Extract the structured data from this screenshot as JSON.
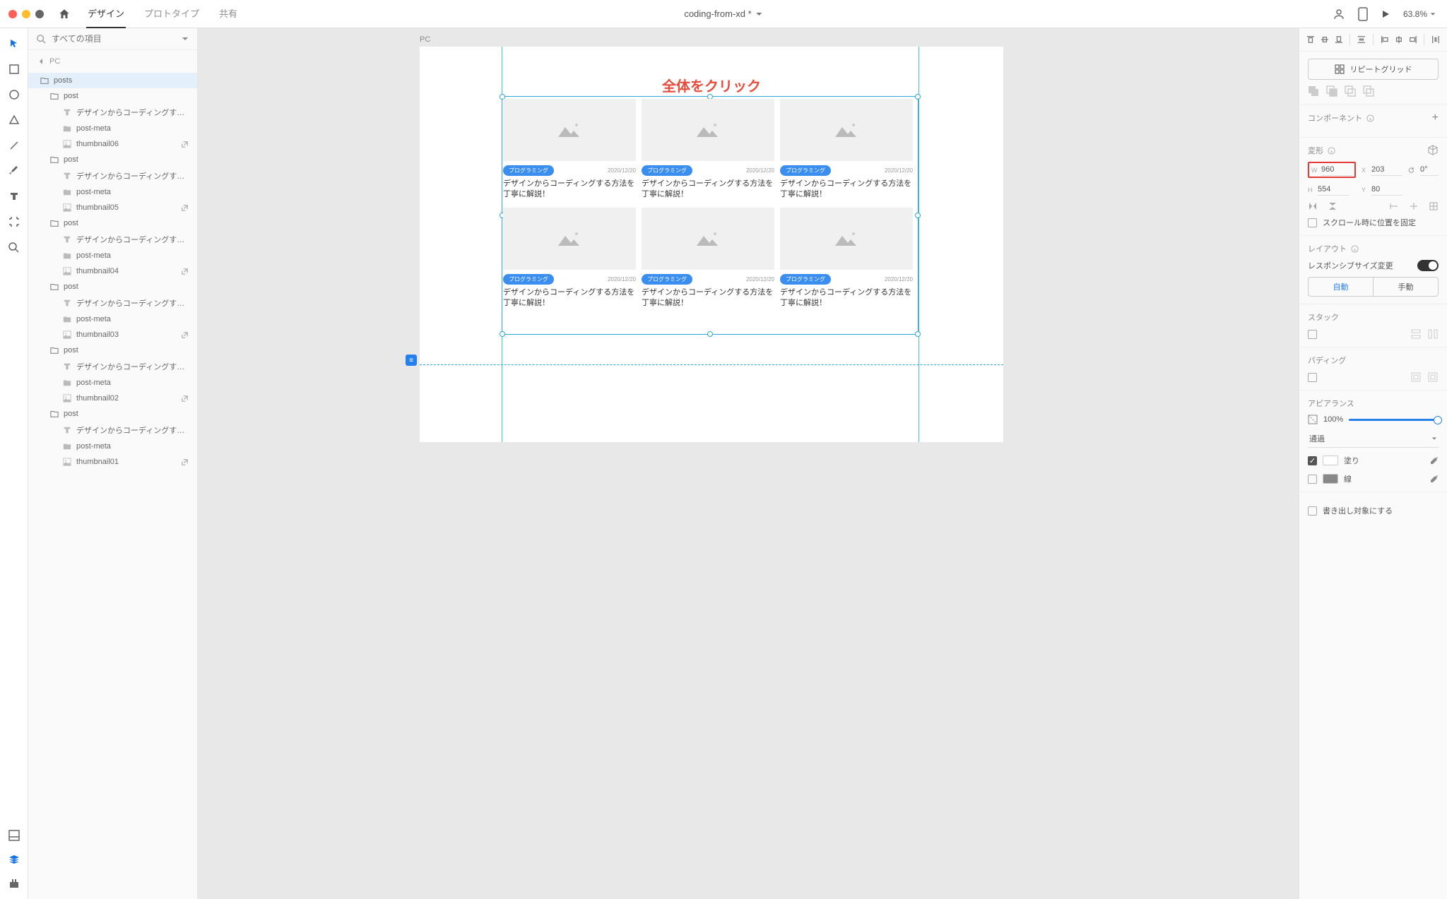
{
  "topbar": {
    "tabs": {
      "design": "デザイン",
      "prototype": "プロトタイプ",
      "share": "共有"
    },
    "title": "coding-from-xd *",
    "zoom": "63.8%"
  },
  "search": {
    "placeholder": "すべての項目"
  },
  "breadcrumb": "PC",
  "layers": [
    {
      "depth": 1,
      "kind": "folder",
      "label": "posts",
      "selected": true
    },
    {
      "depth": 2,
      "kind": "folder",
      "label": "post"
    },
    {
      "depth": 3,
      "kind": "text",
      "label": "デザインからコーディングする方法…"
    },
    {
      "depth": 3,
      "kind": "folder-solid",
      "label": "post-meta"
    },
    {
      "depth": 3,
      "kind": "image",
      "label": "thumbnail06",
      "ext": true
    },
    {
      "depth": 2,
      "kind": "folder",
      "label": "post"
    },
    {
      "depth": 3,
      "kind": "text",
      "label": "デザインからコーディングする方法…"
    },
    {
      "depth": 3,
      "kind": "folder-solid",
      "label": "post-meta"
    },
    {
      "depth": 3,
      "kind": "image",
      "label": "thumbnail05",
      "ext": true
    },
    {
      "depth": 2,
      "kind": "folder",
      "label": "post"
    },
    {
      "depth": 3,
      "kind": "text",
      "label": "デザインからコーディングする方法…"
    },
    {
      "depth": 3,
      "kind": "folder-solid",
      "label": "post-meta"
    },
    {
      "depth": 3,
      "kind": "image",
      "label": "thumbnail04",
      "ext": true
    },
    {
      "depth": 2,
      "kind": "folder",
      "label": "post"
    },
    {
      "depth": 3,
      "kind": "text",
      "label": "デザインからコーディングする方法…"
    },
    {
      "depth": 3,
      "kind": "folder-solid",
      "label": "post-meta"
    },
    {
      "depth": 3,
      "kind": "image",
      "label": "thumbnail03",
      "ext": true
    },
    {
      "depth": 2,
      "kind": "folder",
      "label": "post"
    },
    {
      "depth": 3,
      "kind": "text",
      "label": "デザインからコーディングする方法…"
    },
    {
      "depth": 3,
      "kind": "folder-solid",
      "label": "post-meta"
    },
    {
      "depth": 3,
      "kind": "image",
      "label": "thumbnail02",
      "ext": true
    },
    {
      "depth": 2,
      "kind": "folder",
      "label": "post"
    },
    {
      "depth": 3,
      "kind": "text",
      "label": "デザインからコーディングする方法…"
    },
    {
      "depth": 3,
      "kind": "folder-solid",
      "label": "post-meta"
    },
    {
      "depth": 3,
      "kind": "image",
      "label": "thumbnail01",
      "ext": true
    }
  ],
  "canvas": {
    "artboard_label": "PC",
    "annotation": "全体をクリック",
    "card": {
      "tag": "プログラミング",
      "date": "2020/12/20",
      "title": "デザインからコーディングする方法を丁寧に解説！"
    }
  },
  "props": {
    "repeat_grid": "リピートグリッド",
    "component_head": "コンポーネント",
    "transform_head": "変形",
    "W": "960",
    "X": "203",
    "H": "554",
    "Y": "80",
    "rotation": "0°",
    "scroll_fix": "スクロール時に位置を固定",
    "layout_head": "レイアウト",
    "responsive": "レスポンシブサイズ変更",
    "seg_auto": "自動",
    "seg_manual": "手動",
    "stack_head": "スタック",
    "padding_head": "パディング",
    "appearance_head": "アピアランス",
    "opacity": "100%",
    "blend_mode": "通過",
    "fill_label": "塗り",
    "stroke_label": "線",
    "export_label": "書き出し対象にする"
  }
}
